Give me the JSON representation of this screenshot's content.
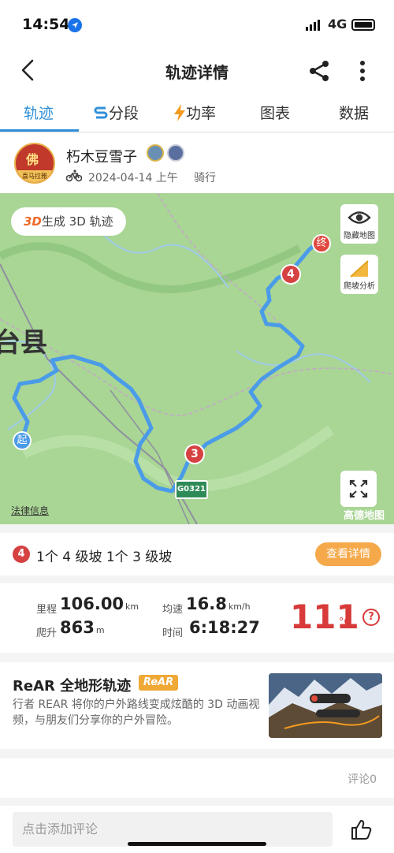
{
  "status": {
    "time": "14:54",
    "network": "4G"
  },
  "nav": {
    "title": "轨迹详情"
  },
  "tabs": [
    {
      "label": "轨迹",
      "active": true
    },
    {
      "label": "分段",
      "icon": "segment-icon"
    },
    {
      "label": "功率",
      "icon": "lightning-icon"
    },
    {
      "label": "图表"
    },
    {
      "label": "数据"
    }
  ],
  "user": {
    "name": "朽木豆雪子",
    "avatar_char": "佛",
    "avatar_tag": "喜马拉雅",
    "date": "2024-04-14 上午",
    "activity": "骑行"
  },
  "map": {
    "generate_3d_prefix": "3D",
    "generate_3d_label": "生成 3D 轨迹",
    "hide_map_label": "隐藏地图",
    "climb_label": "爬坡分析",
    "county_label": "台县",
    "start_label": "起",
    "end_label": "终",
    "road_label": "G0321",
    "marker_4": "4",
    "marker_3": "3",
    "legal_label": "法律信息",
    "provider_label": "高德地图",
    "colors": {
      "route": "#4a9be8",
      "land": "#a9d595",
      "marker": "#d64141"
    }
  },
  "slopes": {
    "icon_text": "4",
    "text": "1个 4 级坡 1个 3 级坡",
    "detail_button": "查看详情"
  },
  "stats": {
    "distance_label": "里程",
    "distance_value": "106.00",
    "distance_unit": "km",
    "climb_label": "爬升",
    "climb_value": "863",
    "climb_unit": "m",
    "speed_label": "均速",
    "speed_value": "16.8",
    "speed_unit": "km/h",
    "time_label": "时间",
    "time_value": "6:18:27",
    "temp_value": "111",
    "temp_unit": "°C",
    "help": "?"
  },
  "rear": {
    "title": "ReAR 全地形轨迹",
    "logo": "ReAR",
    "description": "行者 REAR 将你的户外路线变成炫酷的 3D 动画视频，与朋友们分享你的户外冒险。"
  },
  "comments": {
    "count_label": "评论0",
    "input_placeholder": "点击添加评论"
  }
}
